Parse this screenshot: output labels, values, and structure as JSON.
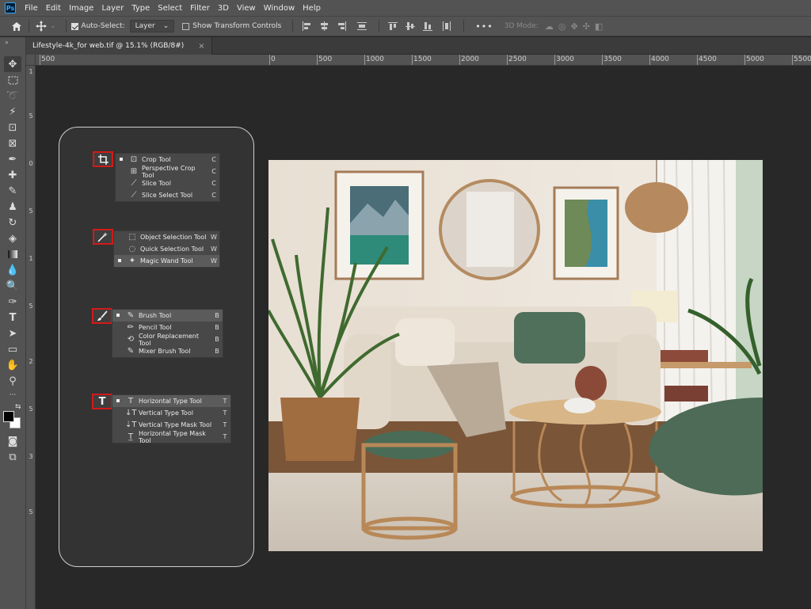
{
  "app": {
    "logo": "Ps"
  },
  "menu": [
    "File",
    "Edit",
    "Image",
    "Layer",
    "Type",
    "Select",
    "Filter",
    "3D",
    "View",
    "Window",
    "Help"
  ],
  "options": {
    "auto_select_label": "Auto-Select:",
    "auto_select_target": "Layer",
    "transform_controls_label": "Show Transform Controls",
    "mode_3d_label": "3D Mode:",
    "more_label": "•••"
  },
  "document_tab": {
    "title": "Lifestyle-4k_for web.tif @ 15.1% (RGB/8#)",
    "close": "×"
  },
  "ruler_h": [
    "500",
    "0",
    "500",
    "1000",
    "1500",
    "2000",
    "2500",
    "3000",
    "3500",
    "4000",
    "4500",
    "5000",
    "5500"
  ],
  "ruler_v": [
    "1",
    "5",
    "0",
    "5",
    "1",
    "5",
    "2",
    "5",
    "3",
    "5"
  ],
  "tool_groups": [
    {
      "group_icon": "crop-icon",
      "items": [
        {
          "label": "Crop Tool",
          "key": "C",
          "icon": "⊡",
          "selected": false,
          "bullet": true
        },
        {
          "label": "Perspective Crop Tool",
          "key": "C",
          "icon": "⊞",
          "selected": false,
          "bullet": false
        },
        {
          "label": "Slice Tool",
          "key": "C",
          "icon": "⟋",
          "selected": false,
          "bullet": false
        },
        {
          "label": "Slice Select Tool",
          "key": "C",
          "icon": "⟋",
          "selected": false,
          "bullet": false
        }
      ]
    },
    {
      "group_icon": "magic-wand-icon",
      "items": [
        {
          "label": "Object Selection Tool",
          "key": "W",
          "icon": "⬚",
          "selected": false,
          "bullet": false
        },
        {
          "label": "Quick Selection Tool",
          "key": "W",
          "icon": "◌",
          "selected": false,
          "bullet": false
        },
        {
          "label": "Magic Wand Tool",
          "key": "W",
          "icon": "✦",
          "selected": true,
          "bullet": true
        }
      ]
    },
    {
      "group_icon": "brush-icon",
      "items": [
        {
          "label": "Brush Tool",
          "key": "B",
          "icon": "✎",
          "selected": true,
          "bullet": true
        },
        {
          "label": "Pencil Tool",
          "key": "B",
          "icon": "✏",
          "selected": false,
          "bullet": false
        },
        {
          "label": "Color Replacement Tool",
          "key": "B",
          "icon": "⟲",
          "selected": false,
          "bullet": false
        },
        {
          "label": "Mixer Brush Tool",
          "key": "B",
          "icon": "✎",
          "selected": false,
          "bullet": false
        }
      ]
    },
    {
      "group_icon": "type-icon",
      "items": [
        {
          "label": "Horizontal Type Tool",
          "key": "T",
          "icon": "T",
          "selected": true,
          "bullet": true
        },
        {
          "label": "Vertical Type Tool",
          "key": "T",
          "icon": "↓T",
          "selected": false,
          "bullet": false
        },
        {
          "label": "Vertical Type Mask Tool",
          "key": "T",
          "icon": "⇣T",
          "selected": false,
          "bullet": false
        },
        {
          "label": "Horizontal Type Mask Tool",
          "key": "T",
          "icon": "T̲",
          "selected": false,
          "bullet": false
        }
      ]
    }
  ]
}
